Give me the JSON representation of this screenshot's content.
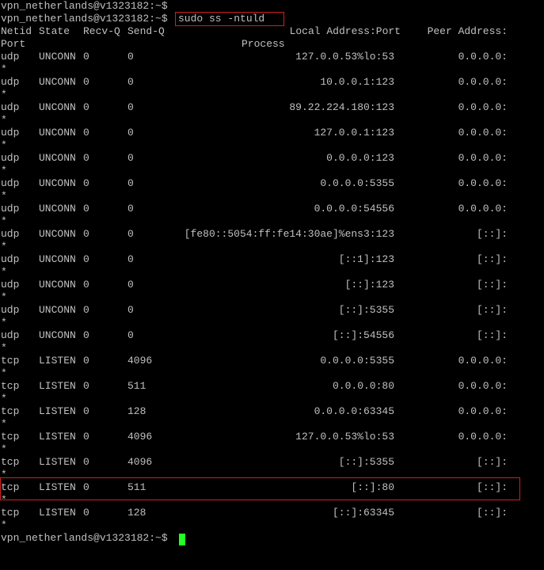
{
  "terminal": {
    "prompt": "vpn_netherlands@v1323182:~$",
    "command": "sudo ss -ntuld",
    "header": {
      "netid": "Netid",
      "state": "State",
      "recvq": "Recv-Q",
      "sendq": "Send-Q",
      "local": "Local Address:Port",
      "peer": "Peer Address:",
      "port": "Port",
      "process": "Process"
    },
    "rows": [
      {
        "netid": "udp",
        "state": "UNCONN",
        "recvq": "0",
        "sendq": "0",
        "local": "127.0.0.53%lo:53",
        "peer": "0.0.0.0:",
        "cont": "*"
      },
      {
        "netid": "udp",
        "state": "UNCONN",
        "recvq": "0",
        "sendq": "0",
        "local": "10.0.0.1:123",
        "peer": "0.0.0.0:",
        "cont": "*"
      },
      {
        "netid": "udp",
        "state": "UNCONN",
        "recvq": "0",
        "sendq": "0",
        "local": "89.22.224.180:123",
        "peer": "0.0.0.0:",
        "cont": "*"
      },
      {
        "netid": "udp",
        "state": "UNCONN",
        "recvq": "0",
        "sendq": "0",
        "local": "127.0.0.1:123",
        "peer": "0.0.0.0:",
        "cont": "*"
      },
      {
        "netid": "udp",
        "state": "UNCONN",
        "recvq": "0",
        "sendq": "0",
        "local": "0.0.0.0:123",
        "peer": "0.0.0.0:",
        "cont": "*"
      },
      {
        "netid": "udp",
        "state": "UNCONN",
        "recvq": "0",
        "sendq": "0",
        "local": "0.0.0.0:5355",
        "peer": "0.0.0.0:",
        "cont": "*"
      },
      {
        "netid": "udp",
        "state": "UNCONN",
        "recvq": "0",
        "sendq": "0",
        "local": "0.0.0.0:54556",
        "peer": "0.0.0.0:",
        "cont": "*"
      },
      {
        "netid": "udp",
        "state": "UNCONN",
        "recvq": "0",
        "sendq": "0",
        "local": "[fe80::5054:ff:fe14:30ae]%ens3:123",
        "peer": "[::]:",
        "cont": "*"
      },
      {
        "netid": "udp",
        "state": "UNCONN",
        "recvq": "0",
        "sendq": "0",
        "local": "[::1]:123",
        "peer": "[::]:",
        "cont": "*"
      },
      {
        "netid": "udp",
        "state": "UNCONN",
        "recvq": "0",
        "sendq": "0",
        "local": "[::]:123",
        "peer": "[::]:",
        "cont": "*"
      },
      {
        "netid": "udp",
        "state": "UNCONN",
        "recvq": "0",
        "sendq": "0",
        "local": "[::]:5355",
        "peer": "[::]:",
        "cont": "*"
      },
      {
        "netid": "udp",
        "state": "UNCONN",
        "recvq": "0",
        "sendq": "0",
        "local": "[::]:54556",
        "peer": "[::]:",
        "cont": "*"
      },
      {
        "netid": "tcp",
        "state": "LISTEN",
        "recvq": "0",
        "sendq": "4096",
        "local": "0.0.0.0:5355",
        "peer": "0.0.0.0:",
        "cont": "*"
      },
      {
        "netid": "tcp",
        "state": "LISTEN",
        "recvq": "0",
        "sendq": "511",
        "local": "0.0.0.0:80",
        "peer": "0.0.0.0:",
        "cont": "*"
      },
      {
        "netid": "tcp",
        "state": "LISTEN",
        "recvq": "0",
        "sendq": "128",
        "local": "0.0.0.0:63345",
        "peer": "0.0.0.0:",
        "cont": "*"
      },
      {
        "netid": "tcp",
        "state": "LISTEN",
        "recvq": "0",
        "sendq": "4096",
        "local": "127.0.0.53%lo:53",
        "peer": "0.0.0.0:",
        "cont": "*"
      },
      {
        "netid": "tcp",
        "state": "LISTEN",
        "recvq": "0",
        "sendq": "4096",
        "local": "[::]:5355",
        "peer": "[::]:",
        "cont": "*"
      },
      {
        "netid": "tcp",
        "state": "LISTEN",
        "recvq": "0",
        "sendq": "511",
        "local": "[::]:80",
        "peer": "[::]:",
        "cont": "*"
      },
      {
        "netid": "tcp",
        "state": "LISTEN",
        "recvq": "0",
        "sendq": "128",
        "local": "[::]:63345",
        "peer": "[::]:",
        "cont": "*"
      }
    ],
    "colors": {
      "background": "#000000",
      "text": "#c0c0c0",
      "highlight": "#d22020",
      "cursor": "#22ff22"
    }
  }
}
